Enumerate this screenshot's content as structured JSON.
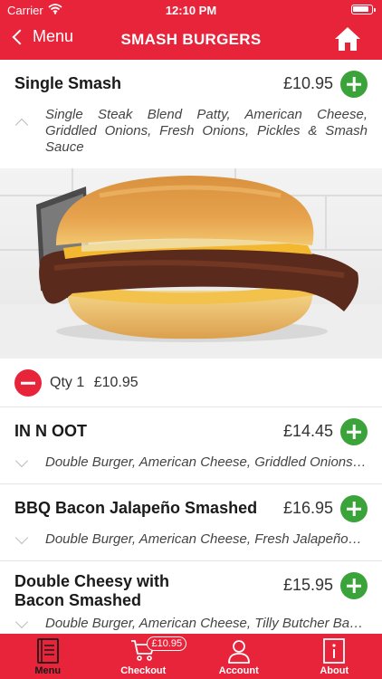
{
  "status": {
    "carrier": "Carrier",
    "time": "12:10 PM"
  },
  "nav": {
    "back_label": "Menu",
    "title": "SMASH BURGERS"
  },
  "colors": {
    "brand_red": "#e8243b",
    "add_green": "#3aa33a"
  },
  "items": [
    {
      "name": "Single Smash",
      "price": "£10.95",
      "description": "Single Steak Blend Patty, American Cheese, Griddled Onions, Fresh Onions, Pickles & Smash Sauce",
      "expanded": true,
      "quantity_text": "Qty 1",
      "quantity_price": "£10.95"
    },
    {
      "name": "IN N OOT",
      "price": "£14.45",
      "description": "Double Burger, American Cheese, Griddled Onions, Fresh Onions, Pickles",
      "expanded": false
    },
    {
      "name": "BBQ Bacon Jalapeño Smashed",
      "price": "£16.95",
      "description": "Double Burger, American Cheese, Fresh Jalapeños, Bacon",
      "expanded": false
    },
    {
      "name_line1": "Double Cheesy with",
      "name_line2": "Bacon Smashed",
      "price": "£15.95",
      "description": "Double Burger, American Cheese, Tilly Butcher Bacon",
      "expanded": false
    }
  ],
  "tabbar": {
    "tabs": [
      {
        "label": "Menu",
        "icon": "menu-book-icon",
        "active": true
      },
      {
        "label": "Checkout",
        "icon": "cart-icon",
        "badge": "£10.95"
      },
      {
        "label": "Account",
        "icon": "user-icon"
      },
      {
        "label": "About",
        "icon": "info-icon"
      }
    ]
  }
}
